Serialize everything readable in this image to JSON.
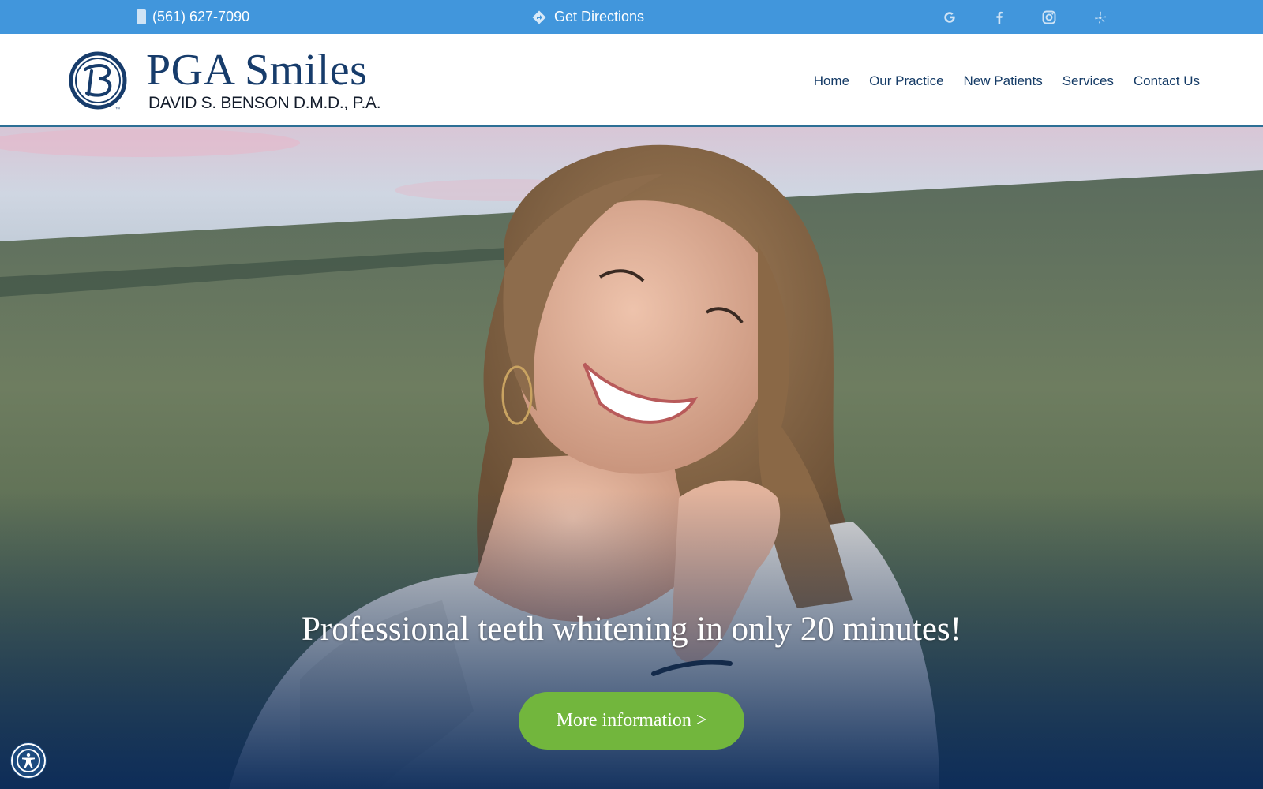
{
  "topbar": {
    "phone": "(561) 627-7090",
    "phone_icon": "phone-icon",
    "directions": "Get Directions",
    "directions_icon": "directions-sign-icon",
    "social": [
      {
        "name": "google-icon"
      },
      {
        "name": "facebook-icon"
      },
      {
        "name": "instagram-icon"
      },
      {
        "name": "yelp-icon"
      }
    ],
    "background_color": "#4196dc"
  },
  "header": {
    "logo_name": "PGA Smiles",
    "logo_subtitle": "DAVID S. BENSON D.M.D., P.A.",
    "logo_trademark": "™",
    "nav": [
      "Home",
      "Our Practice",
      "New Patients",
      "Services",
      "Contact Us"
    ],
    "brand_color": "#173c6b"
  },
  "hero": {
    "headline": "Professional teeth whitening in only 20 minutes!",
    "cta_label": "More information >",
    "cta_color": "#72b63d",
    "image": "smiling-woman-in-grass-field-photo"
  },
  "accessibility": {
    "icon": "accessibility-icon"
  }
}
